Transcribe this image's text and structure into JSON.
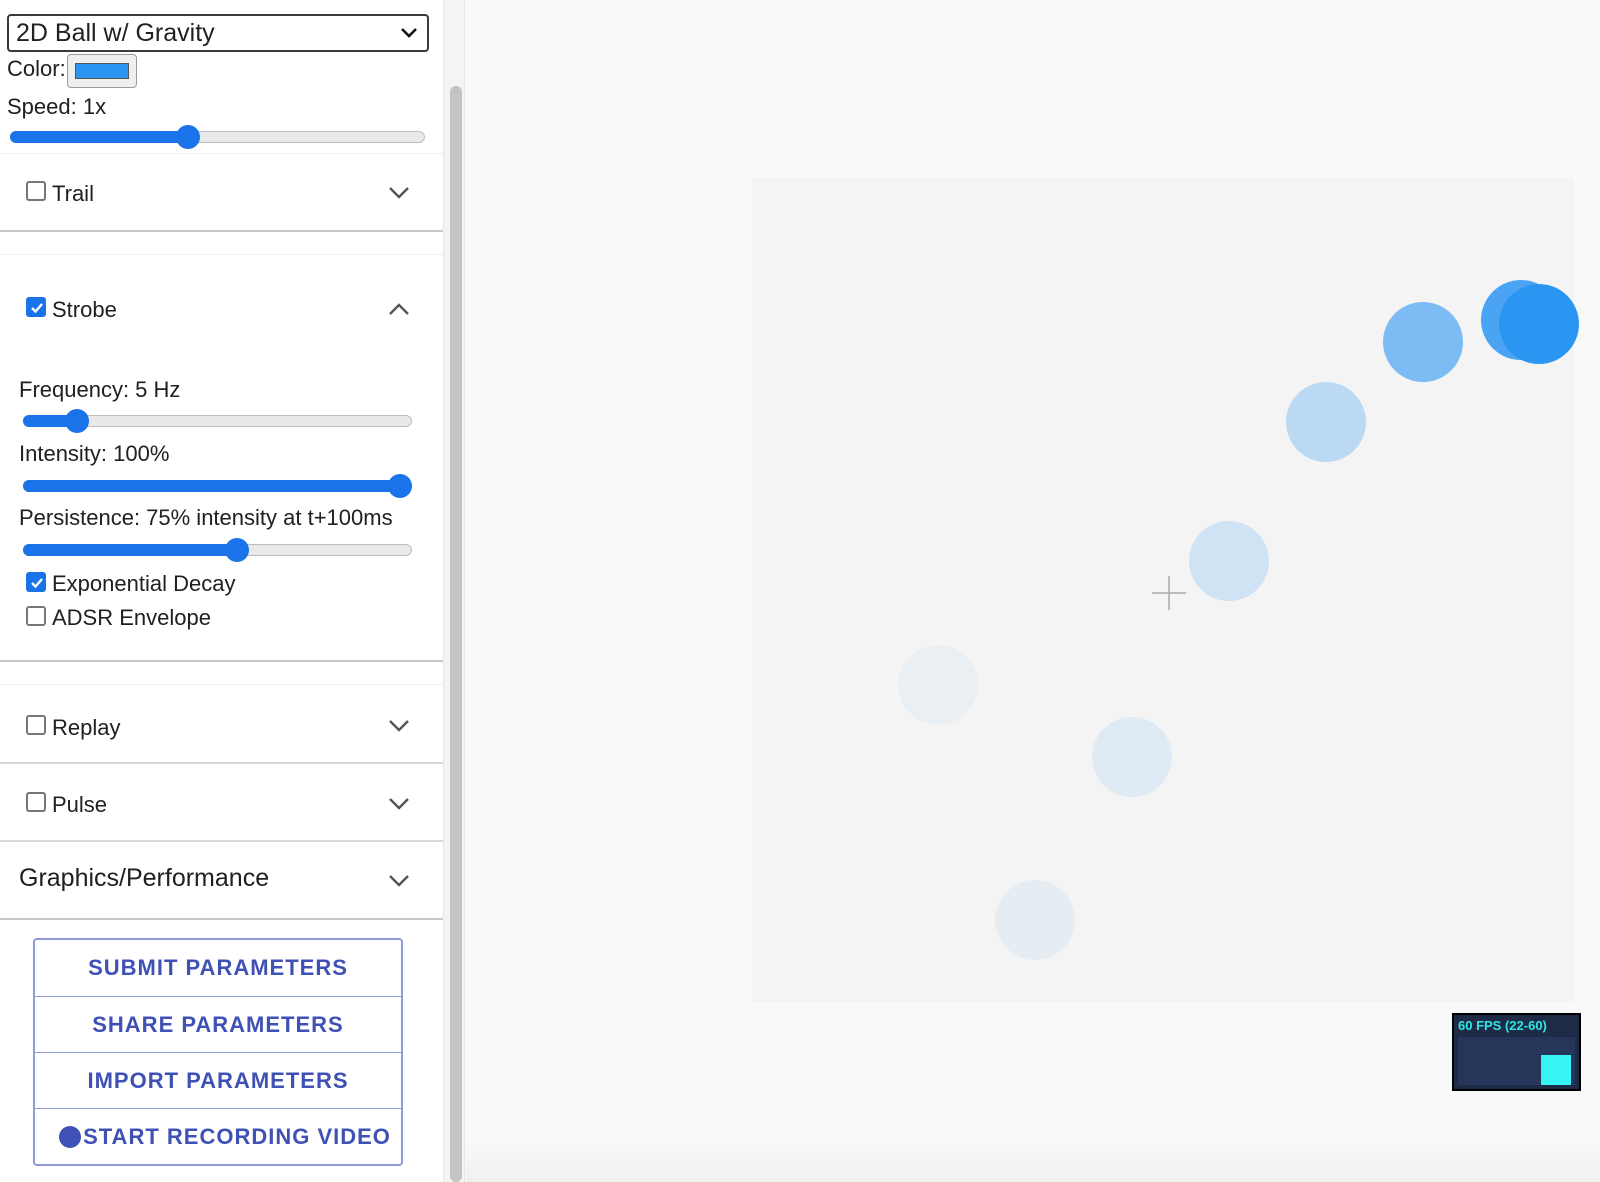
{
  "simulation_select": {
    "selected": "2D Ball w/ Gravity"
  },
  "color": {
    "label": "Color:",
    "value": "#2b95f2"
  },
  "speed": {
    "label": "Speed: 1x",
    "value_fraction": 0.43
  },
  "sections": {
    "trail": {
      "label": "Trail",
      "checked": false,
      "expanded": false
    },
    "strobe": {
      "label": "Strobe",
      "checked": true,
      "expanded": true,
      "frequency": {
        "label": "Frequency: 5 Hz",
        "value_fraction": 0.14
      },
      "intensity": {
        "label": "Intensity: 100%",
        "value_fraction": 1.0
      },
      "persistence": {
        "label": "Persistence: 75% intensity at t+100ms",
        "value_fraction": 0.55
      },
      "exponential_decay": {
        "label": "Exponential Decay",
        "checked": true
      },
      "adsr_envelope": {
        "label": "ADSR Envelope",
        "checked": false
      }
    },
    "replay": {
      "label": "Replay",
      "checked": false,
      "expanded": false
    },
    "pulse": {
      "label": "Pulse",
      "checked": false,
      "expanded": false
    },
    "graphics": {
      "label": "Graphics/Performance",
      "expanded": false
    }
  },
  "buttons": {
    "submit": "SUBMIT PARAMETERS",
    "share": "SHARE PARAMETERS",
    "import": "IMPORT PARAMETERS",
    "record": "START RECORDING VIDEO"
  },
  "fps_meter": {
    "label": "60 FPS (22-60)"
  },
  "colors": {
    "accent": "#1a73e8",
    "ball": "#2b95f2",
    "button_text": "#3f51b5",
    "fps_text": "#2ee6e6"
  },
  "icons": [
    "chevron-down-icon",
    "chevron-up-icon",
    "checkmark-icon",
    "crosshair-icon",
    "record-dot-icon"
  ]
}
